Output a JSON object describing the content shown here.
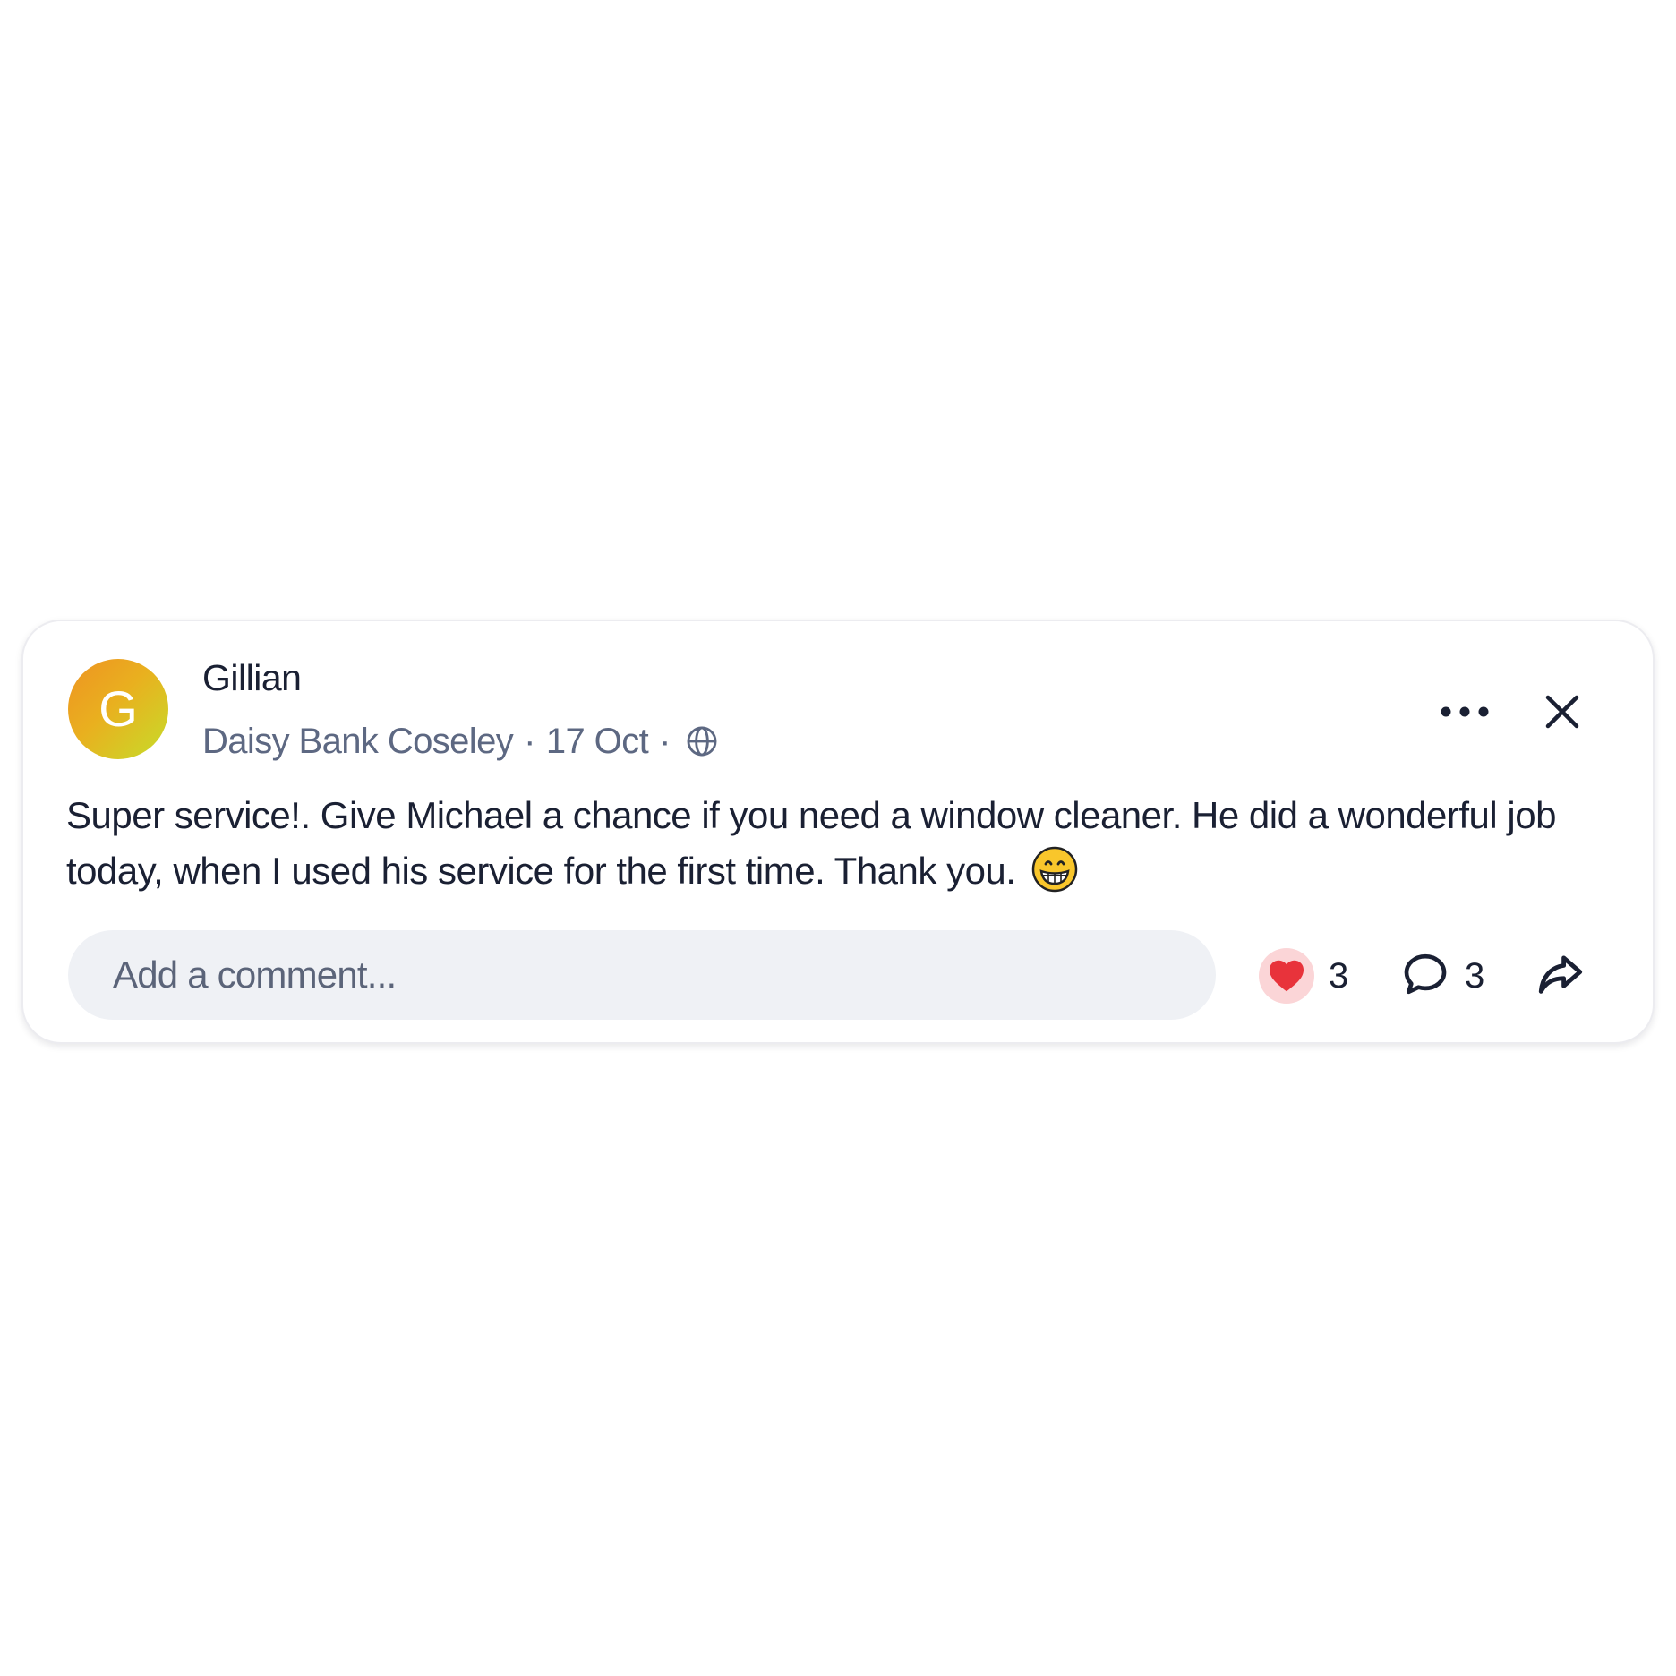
{
  "post": {
    "avatar_initial": "G",
    "avatar_colors": [
      "#ee9322",
      "#c6dd2a"
    ],
    "author": "Gillian",
    "location": "Daisy Bank Coseley",
    "separator": "·",
    "date": "17 Oct",
    "visibility_icon": "globe-icon",
    "text": "Super service!. Give Michael a chance if you need a window cleaner. He did a wonderful job today, when I used his service for the first time. Thank you.",
    "emoji": "grinning-face-emoji"
  },
  "header_actions": {
    "more_icon": "more-dots-icon",
    "close_icon": "close-icon"
  },
  "comment_input": {
    "placeholder": "Add a comment..."
  },
  "reactions": {
    "like_icon": "heart-icon",
    "like_count": "3",
    "comment_icon": "speech-bubble-icon",
    "comment_count": "3",
    "share_icon": "share-arrow-icon"
  },
  "colors": {
    "text": "#1a2033",
    "meta_text": "#5d6882",
    "comment_bg": "#eff1f5",
    "heart": "#e8333b",
    "heart_bg": "#fbd5d7"
  }
}
